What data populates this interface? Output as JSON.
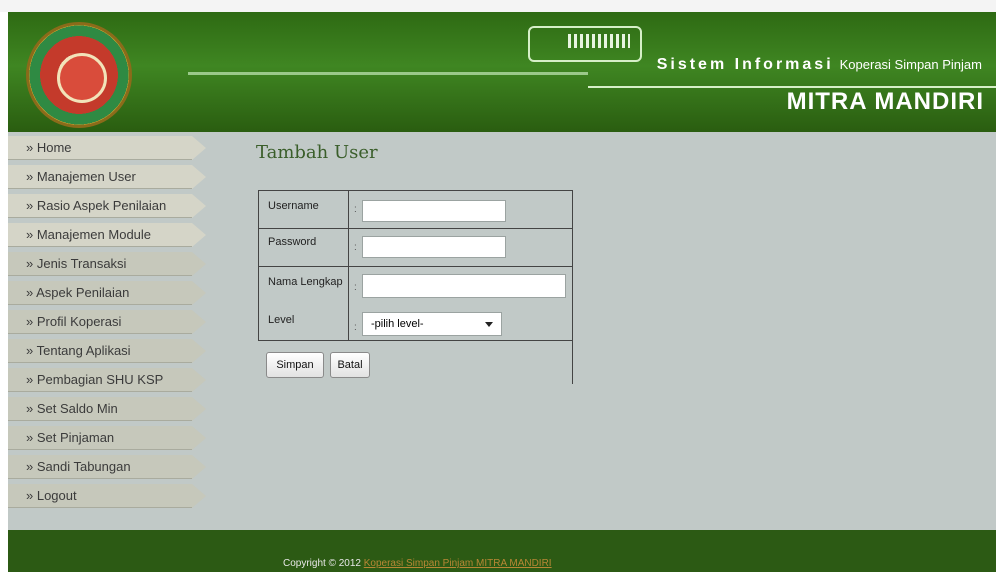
{
  "header": {
    "title_main": "Sistem Informasi",
    "title_rest": "Koperasi Simpan Pinjam",
    "subtitle": "MITRA MANDIRI"
  },
  "sidebar": {
    "items": [
      {
        "label": "» Home"
      },
      {
        "label": "» Manajemen User"
      },
      {
        "label": "» Rasio Aspek Penilaian"
      },
      {
        "label": "» Manajemen Module"
      },
      {
        "label": "» Jenis Transaksi"
      },
      {
        "label": "» Aspek Penilaian"
      },
      {
        "label": "» Profil Koperasi"
      },
      {
        "label": "» Tentang Aplikasi"
      },
      {
        "label": "» Pembagian SHU KSP"
      },
      {
        "label": "» Set Saldo Min"
      },
      {
        "label": "» Set Pinjaman"
      },
      {
        "label": "» Sandi Tabungan"
      },
      {
        "label": "» Logout"
      }
    ]
  },
  "page": {
    "title": "Tambah User"
  },
  "form": {
    "username_label": "Username",
    "password_label": "Password",
    "nama_label": "Nama Lengkap",
    "level_label": "Level",
    "colon": ":",
    "username_value": "",
    "password_value": "",
    "nama_value": "",
    "level_selected": "-pilih level-",
    "save_label": "Simpan",
    "cancel_label": "Batal"
  },
  "footer": {
    "copyright": "Copyright © 2012",
    "link_text": "Koperasi Simpan Pinjam MITRA MANDIRI"
  },
  "colors": {
    "header_green": "#3f8622",
    "footer_green": "#2c5a14",
    "main_grey": "#c1c9c7"
  }
}
